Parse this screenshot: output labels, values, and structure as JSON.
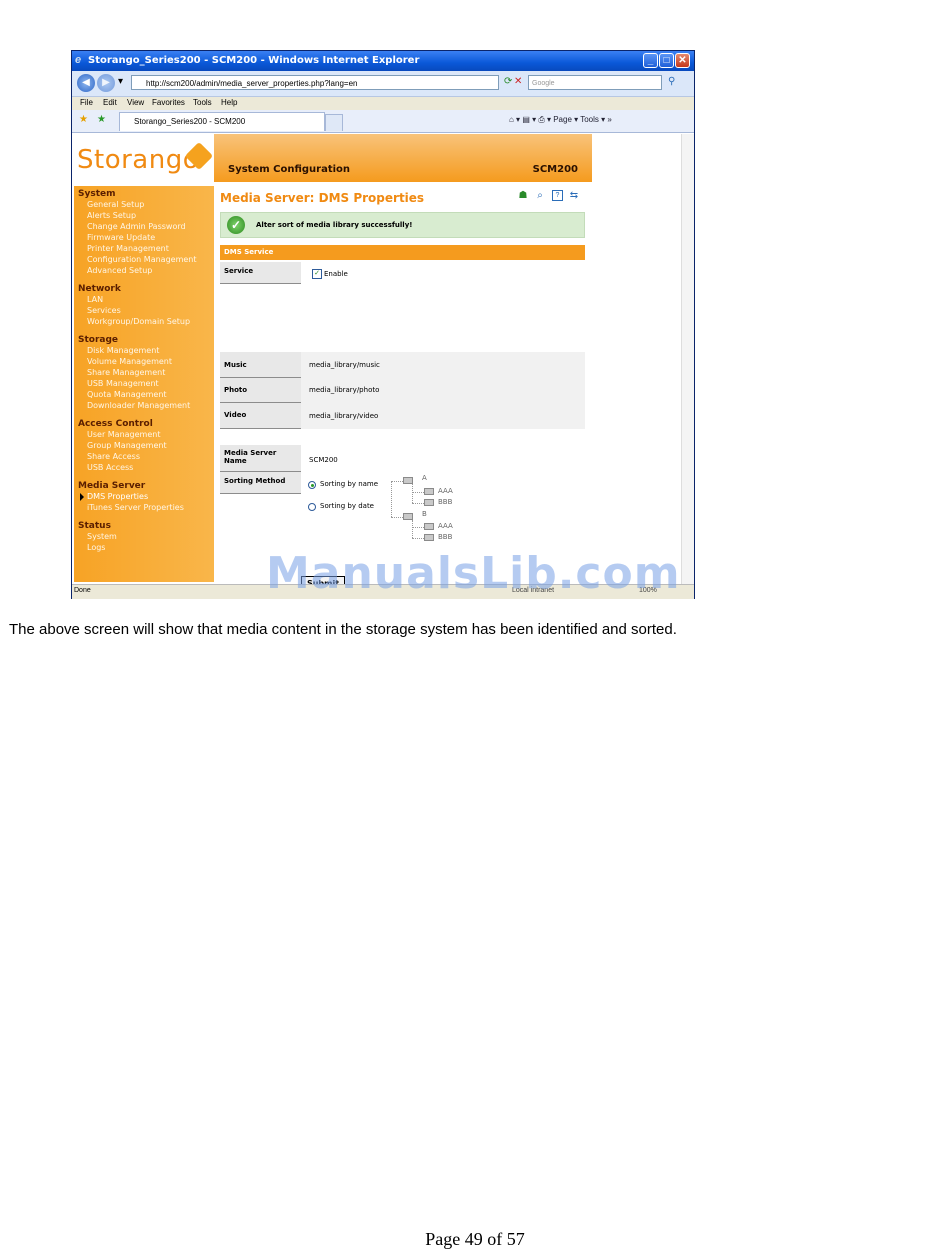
{
  "browser": {
    "title": "Storango_Series200 - SCM200 - Windows Internet Explorer",
    "address": "http://scm200/admin/media_server_properties.php?lang=en",
    "search_placeholder": "Google",
    "menu": [
      "File",
      "Edit",
      "View",
      "Favorites",
      "Tools",
      "Help"
    ],
    "tab_label": "Storango_Series200 - SCM200",
    "toolbar_right": "Page ▾   Tools ▾",
    "status_done": "Done",
    "status_zone": "Local intranet",
    "status_zoom": "100%"
  },
  "app": {
    "logo_text": "Storango",
    "header_title": "System Configuration",
    "header_model": "SCM200",
    "page_title": "Media Server: DMS Properties",
    "success_message": "Alter sort of media library successfully!",
    "section_title": "DMS Service",
    "service_label": "Service",
    "enable_label": "Enable",
    "music_label": "Music",
    "music_value": "media_library/music",
    "photo_label": "Photo",
    "photo_value": "media_library/photo",
    "video_label": "Video",
    "video_value": "media_library/video",
    "media_server_name_label": "Media Server Name",
    "media_server_name_value": "SCM200",
    "sorting_label": "Sorting Method",
    "sort_by_name": "Sorting by name",
    "sort_by_date": "Sorting by date",
    "sort_selected": "Sorting by name",
    "tree": {
      "a": "A",
      "b": "B",
      "aaa": "AAA",
      "bbb": "BBB"
    },
    "submit_label": "Submit"
  },
  "sidebar": {
    "groups": [
      {
        "title": "System",
        "items": [
          "General Setup",
          "Alerts Setup",
          "Change Admin Password",
          "Firmware Update",
          "Printer Management",
          "Configuration Management",
          "Advanced Setup"
        ]
      },
      {
        "title": "Network",
        "items": [
          "LAN",
          "Services",
          "Workgroup/Domain Setup"
        ]
      },
      {
        "title": "Storage",
        "items": [
          "Disk Management",
          "Volume Management",
          "Share Management",
          "USB Management",
          "Quota Management",
          "Downloader Management"
        ]
      },
      {
        "title": "Access Control",
        "items": [
          "User Management",
          "Group Management",
          "Share Access",
          "USB Access"
        ]
      },
      {
        "title": "Media Server",
        "items": [
          "DMS Properties",
          "iTunes Server Properties"
        ]
      },
      {
        "title": "Status",
        "items": [
          "System",
          "Logs"
        ]
      }
    ],
    "active_item": "DMS Properties"
  },
  "document": {
    "watermark": "ManualsLib.com",
    "caption": "The above screen will show that media content in the storage system has been identified and sorted.",
    "page_footer": "Page 49 of 57"
  }
}
